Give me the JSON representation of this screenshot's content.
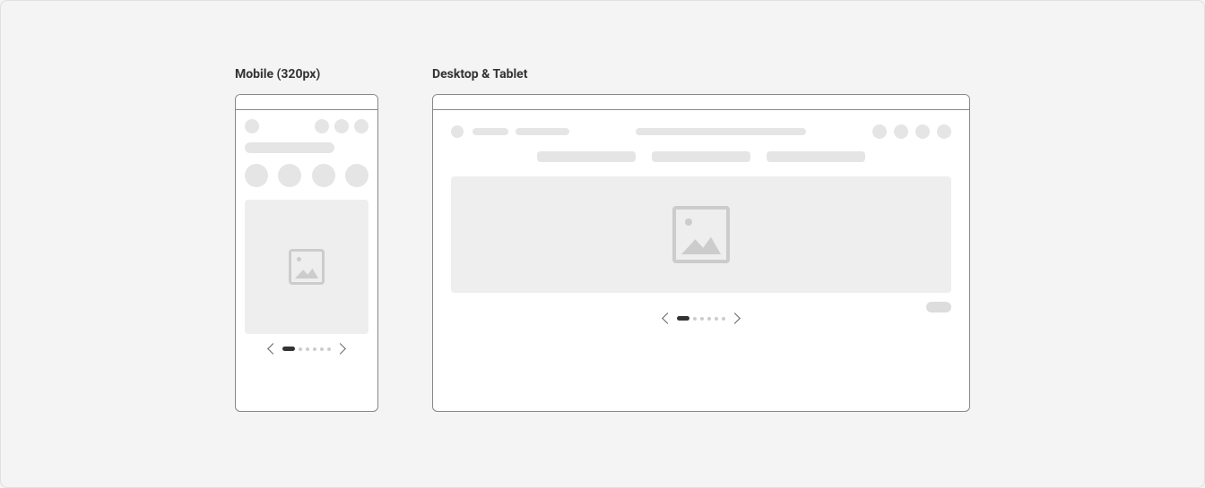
{
  "viewports": {
    "mobile": {
      "label": "Mobile (320px)"
    },
    "desktop": {
      "label": "Desktop & Tablet"
    }
  },
  "carousel": {
    "total_slides": 6,
    "active_index": 0
  }
}
